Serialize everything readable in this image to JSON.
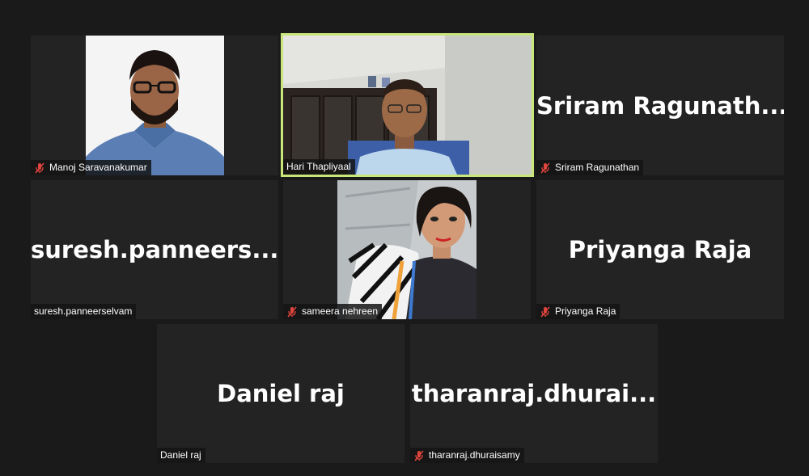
{
  "participants": [
    {
      "name": "Manoj Saravanakumar",
      "muted": true,
      "display": "video"
    },
    {
      "name": "Hari Thapliyaal",
      "muted": false,
      "display": "video",
      "active_speaker": true
    },
    {
      "name": "Sriram Ragunathan",
      "tile_text": "Sriram  Ragunath...",
      "muted": true,
      "display": "name"
    },
    {
      "name": "suresh.panneerselvam",
      "tile_text": "suresh.panneers...",
      "muted": false,
      "display": "name"
    },
    {
      "name": "sameera nehreen",
      "muted": true,
      "display": "video"
    },
    {
      "name": "Priyanga Raja",
      "tile_text": "Priyanga Raja",
      "muted": true,
      "display": "name"
    },
    {
      "name": "Daniel raj",
      "tile_text": "Daniel raj",
      "muted": false,
      "display": "name"
    },
    {
      "name": "tharanraj.dhuraisamy",
      "tile_text": "tharanraj.dhurai...",
      "muted": true,
      "display": "name"
    }
  ],
  "colors": {
    "background": "#1a1a1a",
    "tile": "#232323",
    "active_border": "#c8e67a",
    "mute_icon": "#e0443c"
  }
}
